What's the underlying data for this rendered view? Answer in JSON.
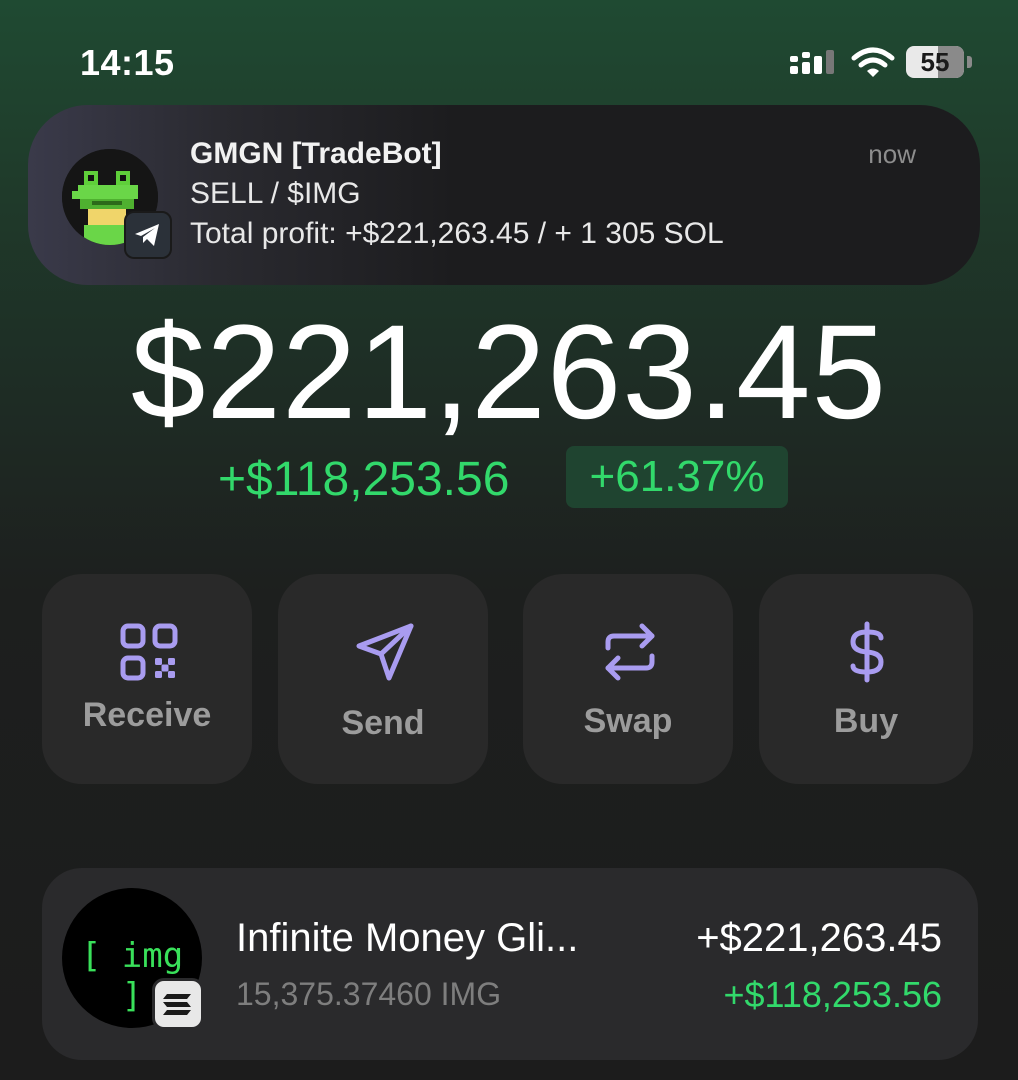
{
  "status_bar": {
    "time": "14:15",
    "battery": "55"
  },
  "notification": {
    "app": "GMGN [TradeBot]",
    "time": "now",
    "line1": "SELL / $IMG",
    "line2": "Total profit: +$221,263.45 / + 1 305 SOL",
    "badge_icon": "telegram-icon"
  },
  "portfolio": {
    "balance": "$221,263.45",
    "change_abs": "+$118,253.56",
    "change_pct": "+61.37%"
  },
  "actions": [
    {
      "label": "Receive",
      "icon": "qr-code-icon"
    },
    {
      "label": "Send",
      "icon": "send-icon"
    },
    {
      "label": "Swap",
      "icon": "swap-icon"
    },
    {
      "label": "Buy",
      "icon": "dollar-icon"
    }
  ],
  "token": {
    "logo_text": "[ img ]",
    "name": "Infinite Money Gli...",
    "amount": "15,375.37460 IMG",
    "value": "+$221,263.45",
    "change": "+$118,253.56",
    "chain_icon": "solana-icon"
  },
  "colors": {
    "accent_green": "#32d96b",
    "icon_purple": "#a99cf0",
    "card_bg": "#292929"
  }
}
